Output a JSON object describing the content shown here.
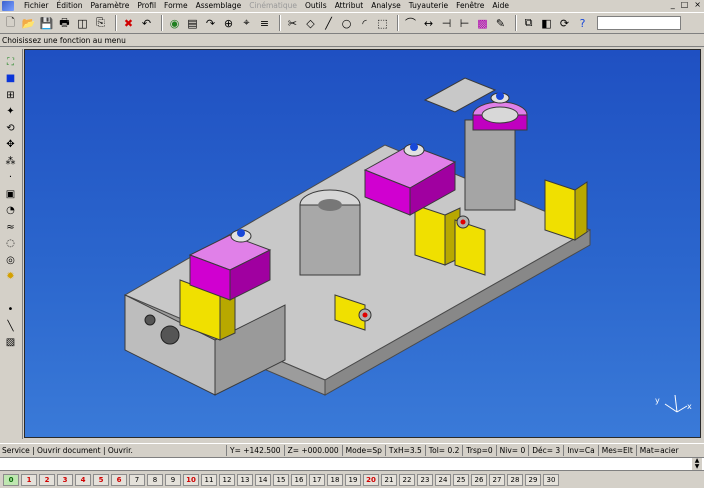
{
  "menubar": {
    "items": [
      "Fichier",
      "Édition",
      "Paramètre",
      "Profil",
      "Forme",
      "Assemblage",
      "Cinématique",
      "Outils",
      "Attribut",
      "Analyse",
      "Tuyauterie",
      "Fenêtre",
      "Aide"
    ],
    "disabled_index": 6
  },
  "window_controls": [
    "_",
    "□",
    "×"
  ],
  "toolbar": {
    "icons": [
      "new-file-icon",
      "open-folder-icon",
      "save-icon",
      "print-icon",
      "preview-icon",
      "copy-icon",
      "delete-icon",
      "undo-icon",
      "render-icon",
      "fill-icon",
      "redo-icon",
      "zoom-icon",
      "measure-icon",
      "layers-icon",
      "cut-icon",
      "node-icon",
      "line-icon",
      "circle-icon",
      "arc-icon",
      "edge-icon",
      "tangent-icon",
      "dimension-icon",
      "trim-icon",
      "extend-icon",
      "color-icon",
      "pen-icon",
      "zoom-window-icon",
      "view-icon",
      "rotate-icon",
      "help-icon"
    ]
  },
  "prompt": {
    "text": "Choisissez une fonction au menu"
  },
  "status": {
    "message": "Service | Ouvrir document | Ouvrir.",
    "cells": [
      "Y= +142.500",
      "Z= +000.000",
      "Mode=Sp",
      "TxH=3.5",
      "Tol=  0.2",
      "Trsp=0",
      "Niv=  0",
      "Déc= 3",
      "Inv=Ca",
      "Mes=Elt",
      "Mat=acier"
    ]
  },
  "axis": {
    "y_label": "y",
    "x_label": "x"
  },
  "layers": {
    "items": [
      "0",
      "1",
      "2",
      "3",
      "4",
      "5",
      "6",
      "7",
      "8",
      "9",
      "10",
      "11",
      "12",
      "13",
      "14",
      "15",
      "16",
      "17",
      "18",
      "19",
      "20",
      "21",
      "22",
      "23",
      "24",
      "25",
      "26",
      "27",
      "28",
      "29",
      "30"
    ],
    "active": "0",
    "red": [
      "1",
      "2",
      "3",
      "4",
      "5",
      "6",
      "10",
      "20"
    ]
  }
}
